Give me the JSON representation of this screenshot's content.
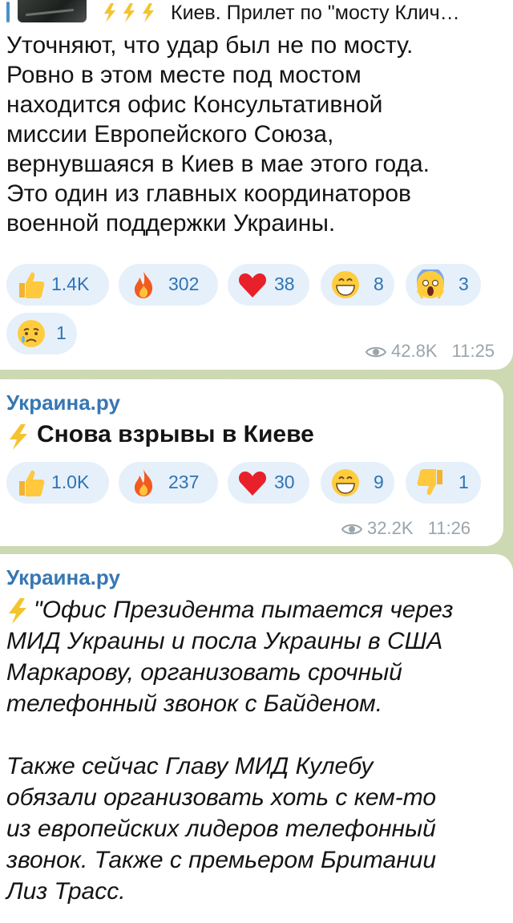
{
  "messages": [
    {
      "reply": {
        "text": "Киев. Прилет по \"мосту Клич…"
      },
      "text": "Уточняют, что удар был не по мосту.\nРовно в этом месте под мостом\nнаходится офис Консультативной\nмиссии Европейского Союза,\nвернувшаяся в Киев в мае этого года.\nЭто один из главных координаторов\nвоенной поддержки Украины.",
      "reactions": [
        {
          "icon": "thumbs-up-icon",
          "count": "1.4K"
        },
        {
          "icon": "fire-icon",
          "count": "302"
        },
        {
          "icon": "heart-icon",
          "count": "38"
        },
        {
          "icon": "grinning-face-icon",
          "count": "8"
        },
        {
          "icon": "screaming-face-icon",
          "count": "3"
        },
        {
          "icon": "crying-face-icon",
          "count": "1"
        }
      ],
      "views": "42.8K",
      "time": "11:25"
    },
    {
      "channel": "Украина.ру",
      "headline": "Снова взрывы в Киеве",
      "reactions": [
        {
          "icon": "thumbs-up-icon",
          "count": "1.0K"
        },
        {
          "icon": "fire-icon",
          "count": "237"
        },
        {
          "icon": "heart-icon",
          "count": "30"
        },
        {
          "icon": "grinning-face-icon",
          "count": "9"
        },
        {
          "icon": "thumbs-down-icon",
          "count": "1"
        }
      ],
      "views": "32.2K",
      "time": "11:26"
    },
    {
      "channel": "Украина.ру",
      "text": "\"Офис Президента пытается через\nМИД Украины и посла Украины в США\nМаркарову, организовать срочный\nтелефонный звонок с Байденом.\n\nТакже сейчас Главу МИД Кулебу\nобязали организовать хоть с кем-то\nиз европейских лидеров телефонный\nзвонок. Также с премьером Британии\nЛиз Трасс."
    }
  ],
  "colors": {
    "background": "#ccd9b2",
    "bubble": "#ffffff",
    "accent": "#3677b3",
    "reaction_bg": "#e6f0fa",
    "meta": "#9aa4ab"
  }
}
